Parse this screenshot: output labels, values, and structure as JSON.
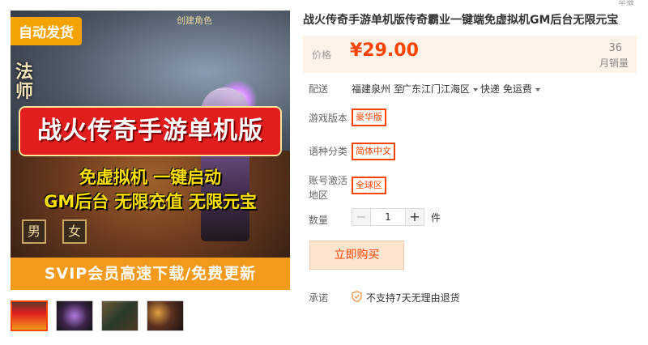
{
  "image": {
    "badge": "自动发货",
    "create_role": "创建角色",
    "left_glyph": "法师",
    "banner": "战火传奇手游单机版",
    "line1": "免虚拟机 一键启动",
    "line2": "GM后台 无限充值 无限元宝",
    "sex_male": "男",
    "sex_female": "女",
    "bottom_strip": "SVIP会员高速下载/免费更新"
  },
  "thumbnails": 4,
  "corner_text": "举报",
  "product": {
    "title": "战火传奇手游单机版传奇霸业一键端免虚拟机GM后台无限元宝",
    "price_label": "价格",
    "price": "¥29.00",
    "sales_count": "36",
    "sales_unit": "月销量"
  },
  "shipping": {
    "label": "配送",
    "from": "福建泉州 至",
    "to": "广东江门江海区",
    "method": "快递 免运费"
  },
  "options": {
    "version_label": "游戏版本",
    "version_value": "豪华版",
    "language_label": "语种分类",
    "language_value": "简体中文",
    "region_label_1": "账号激活",
    "region_label_2": "地区",
    "region_value": "全球区"
  },
  "quantity": {
    "label": "数量",
    "value": "1",
    "unit": "件",
    "minus": "−",
    "plus": "+"
  },
  "buy_button": "立即购买",
  "promise": {
    "label": "承诺",
    "text": "不支持7天无理由退货"
  },
  "colors": {
    "accent": "#ff4400",
    "price_bg": "#fff2e8",
    "buy_bg": "#ffe4d0"
  }
}
